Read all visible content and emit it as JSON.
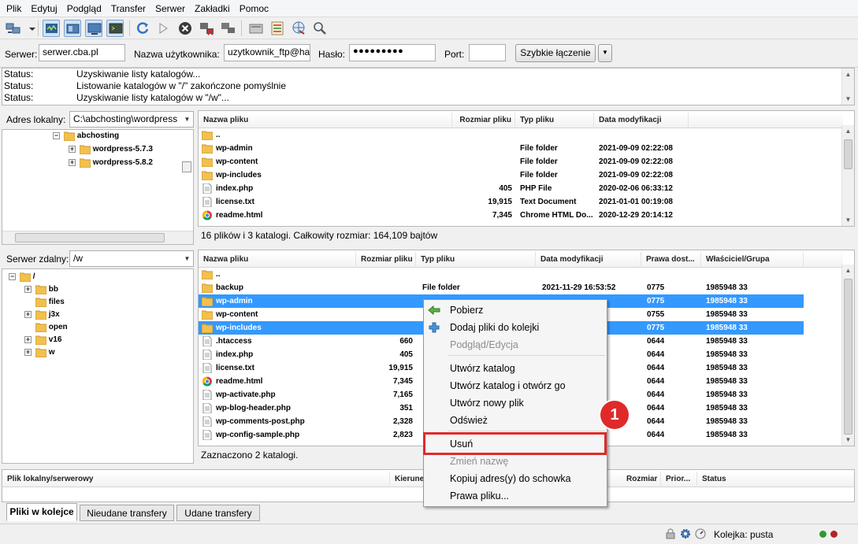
{
  "menu": [
    "Plik",
    "Edytuj",
    "Podgląd",
    "Transfer",
    "Serwer",
    "Zakładki",
    "Pomoc"
  ],
  "toolbar": {
    "icons": [
      "site-manager-icon",
      "dropdown-icon",
      "message-log-icon",
      "local-tree-icon",
      "remote-tree-icon",
      "transfer-queue-icon",
      "refresh-icon",
      "process-queue-icon",
      "cancel-icon",
      "disconnect-icon",
      "reconnect-icon",
      "filter-icon",
      "compare-icon",
      "sync-browse-icon",
      "search-icon"
    ]
  },
  "quickconnect": {
    "host_label": "Serwer:",
    "host_value": "serwer.cba.pl",
    "user_label": "Nazwa użytkownika:",
    "user_value": "uzytkownik_ftp@ha",
    "pass_label": "Hasło:",
    "pass_value": "●●●●●●●●●",
    "port_label": "Port:",
    "port_value": "",
    "button": "Szybkie łączenie",
    "dropdown": "▼"
  },
  "log": [
    {
      "label": "Status:",
      "msg": "Uzyskiwanie listy katalogów..."
    },
    {
      "label": "Status:",
      "msg": "Listowanie katalogów w \"/\" zakończone pomyślnie"
    },
    {
      "label": "Status:",
      "msg": "Uzyskiwanie listy katalogów w \"/w\"..."
    }
  ],
  "local": {
    "label": "Adres lokalny:",
    "path": "C:\\abchosting\\wordpress",
    "tree": [
      {
        "name": "abchosting",
        "expander": "−"
      },
      {
        "name": "wordpress-5.7.3",
        "expander": "+"
      },
      {
        "name": "wordpress-5.8.2",
        "expander": "+"
      }
    ],
    "headers": [
      "Nazwa pliku",
      "Rozmiar pliku",
      "Typ pliku",
      "Data modyfikacji"
    ],
    "rows": [
      {
        "name": "..",
        "size": "",
        "type": "",
        "date": "",
        "icon": "folder"
      },
      {
        "name": "wp-admin",
        "size": "",
        "type": "File folder",
        "date": "2021-09-09 02:22:08",
        "icon": "folder"
      },
      {
        "name": "wp-content",
        "size": "",
        "type": "File folder",
        "date": "2021-09-09 02:22:08",
        "icon": "folder"
      },
      {
        "name": "wp-includes",
        "size": "",
        "type": "File folder",
        "date": "2021-09-09 02:22:08",
        "icon": "folder"
      },
      {
        "name": "index.php",
        "size": "405",
        "type": "PHP File",
        "date": "2020-02-06 06:33:12",
        "icon": "file"
      },
      {
        "name": "license.txt",
        "size": "19,915",
        "type": "Text Document",
        "date": "2021-01-01 00:19:08",
        "icon": "file"
      },
      {
        "name": "readme.html",
        "size": "7,345",
        "type": "Chrome HTML Do...",
        "date": "2020-12-29 20:14:12",
        "icon": "chrome"
      }
    ],
    "status": "16 plików i 3 katalogi. Całkowity rozmiar: 164,109 bajtów"
  },
  "remote": {
    "label": "Serwer zdalny:",
    "path": "/w",
    "tree": [
      {
        "name": "/",
        "expander": "−",
        "level": 0
      },
      {
        "name": "bb",
        "expander": "+",
        "level": 1
      },
      {
        "name": "files",
        "expander": "",
        "level": 1
      },
      {
        "name": "j3x",
        "expander": "+",
        "level": 1
      },
      {
        "name": "open",
        "expander": "",
        "level": 1
      },
      {
        "name": "v16",
        "expander": "+",
        "level": 1
      },
      {
        "name": "w",
        "expander": "+",
        "level": 1
      }
    ],
    "headers": [
      "Nazwa pliku",
      "Rozmiar pliku",
      "Typ pliku",
      "Data modyfikacji",
      "Prawa dost...",
      "Właściciel/Grupa"
    ],
    "rows": [
      {
        "name": "..",
        "size": "",
        "type": "",
        "date": "",
        "perm": "",
        "owner": "",
        "icon": "folder",
        "sel": false
      },
      {
        "name": "backup",
        "size": "",
        "type": "File folder",
        "date": "2021-11-29 16:53:52",
        "perm": "0775",
        "owner": "1985948 33",
        "icon": "folder",
        "sel": false
      },
      {
        "name": "wp-admin",
        "size": "",
        "type": "",
        "date": "",
        "perm": "0775",
        "owner": "1985948 33",
        "icon": "folder",
        "sel": true
      },
      {
        "name": "wp-content",
        "size": "",
        "type": "",
        "date": "",
        "perm": "0755",
        "owner": "1985948 33",
        "icon": "folder",
        "sel": false
      },
      {
        "name": "wp-includes",
        "size": "",
        "type": "",
        "date": "",
        "perm": "0775",
        "owner": "1985948 33",
        "icon": "folder",
        "sel": true
      },
      {
        "name": ".htaccess",
        "size": "660",
        "type": "",
        "date": "",
        "perm": "0644",
        "owner": "1985948 33",
        "icon": "file",
        "sel": false
      },
      {
        "name": "index.php",
        "size": "405",
        "type": "",
        "date": "",
        "perm": "0644",
        "owner": "1985948 33",
        "icon": "file",
        "sel": false
      },
      {
        "name": "license.txt",
        "size": "19,915",
        "type": "",
        "date": "",
        "perm": "0644",
        "owner": "1985948 33",
        "icon": "file",
        "sel": false
      },
      {
        "name": "readme.html",
        "size": "7,345",
        "type": "",
        "date": "",
        "perm": "0644",
        "owner": "1985948 33",
        "icon": "chrome",
        "sel": false
      },
      {
        "name": "wp-activate.php",
        "size": "7,165",
        "type": "",
        "date": "",
        "perm": "0644",
        "owner": "1985948 33",
        "icon": "file",
        "sel": false
      },
      {
        "name": "wp-blog-header.php",
        "size": "351",
        "type": "",
        "date": "",
        "perm": "0644",
        "owner": "1985948 33",
        "icon": "file",
        "sel": false
      },
      {
        "name": "wp-comments-post.php",
        "size": "2,328",
        "type": "",
        "date": "",
        "perm": "0644",
        "owner": "1985948 33",
        "icon": "file",
        "sel": false
      },
      {
        "name": "wp-config-sample.php",
        "size": "2,823",
        "type": "",
        "date": "",
        "perm": "0644",
        "owner": "1985948 33",
        "icon": "file",
        "sel": false
      }
    ],
    "status": "Zaznaczono 2 katalogi."
  },
  "context_menu": {
    "items": [
      {
        "label": "Pobierz",
        "disabled": false,
        "icon": "download-arrow-icon"
      },
      {
        "label": "Dodaj pliki do kolejki",
        "disabled": false,
        "icon": "add-to-queue-icon"
      },
      {
        "label": "Podgląd/Edycja",
        "disabled": true,
        "icon": ""
      },
      {
        "label": "Utwórz katalog",
        "disabled": false,
        "icon": ""
      },
      {
        "label": "Utwórz katalog i otwórz go",
        "disabled": false,
        "icon": ""
      },
      {
        "label": "Utwórz nowy plik",
        "disabled": false,
        "icon": ""
      },
      {
        "label": "Odśwież",
        "disabled": false,
        "icon": ""
      },
      {
        "label": "Usuń",
        "disabled": false,
        "icon": ""
      },
      {
        "label": "Zmień nazwę",
        "disabled": true,
        "icon": ""
      },
      {
        "label": "Kopiuj adres(y) do schowka",
        "disabled": false,
        "icon": ""
      },
      {
        "label": "Prawa pliku...",
        "disabled": false,
        "icon": ""
      }
    ],
    "highlight_badge": "1"
  },
  "queue": {
    "headers": [
      "Plik lokalny/serwerowy",
      "Kierunek",
      "Rozmiar",
      "Prior...",
      "Status"
    ]
  },
  "tabs": [
    "Pliki w kolejce",
    "Nieudane transfery",
    "Udane transfery"
  ],
  "statusbar": {
    "queue": "Kolejka: pusta"
  },
  "colors": {
    "selection": "#3399ff",
    "highlight": "#e02a2a",
    "folder": "#f2c04f"
  }
}
